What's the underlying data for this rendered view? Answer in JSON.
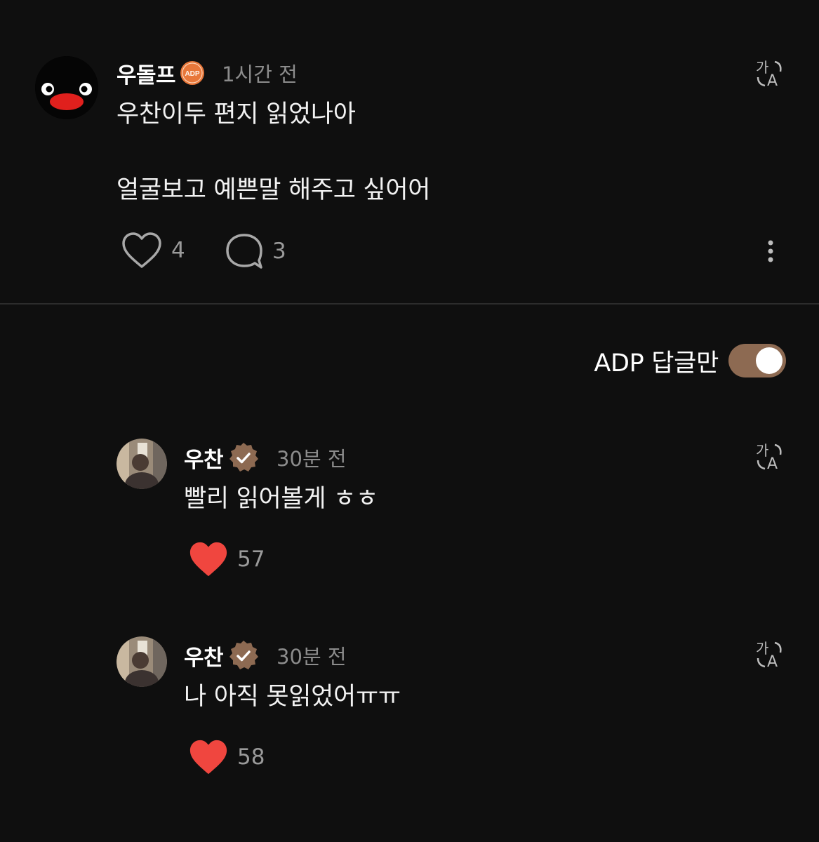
{
  "post": {
    "username": "우돌프",
    "badge_text": "ADP",
    "time": "1시간 전",
    "lines": [
      "우찬이두 편지 읽었나아",
      "",
      "얼굴보고 예쁜말 해주고 싶어어"
    ],
    "likes": "4",
    "replies": "3",
    "translate_icon": "translate-icon",
    "more_icon": "more-vertical-icon"
  },
  "filter": {
    "label": "ADP 답글만",
    "enabled": true
  },
  "replies": [
    {
      "username": "우찬",
      "verified": true,
      "time": "30분 전",
      "text": "빨리 읽어볼게 ㅎㅎ",
      "likes": "57",
      "liked": true
    },
    {
      "username": "우찬",
      "verified": true,
      "time": "30분 전",
      "text": "나 아직 못읽었어ㅠㅠ",
      "likes": "58",
      "liked": true
    }
  ],
  "colors": {
    "background": "#0f0f0f",
    "heart": "#f0463f",
    "toggle": "#8d6a52",
    "badge_orange": "#e8773a",
    "verified_brown": "#8d6a52"
  }
}
